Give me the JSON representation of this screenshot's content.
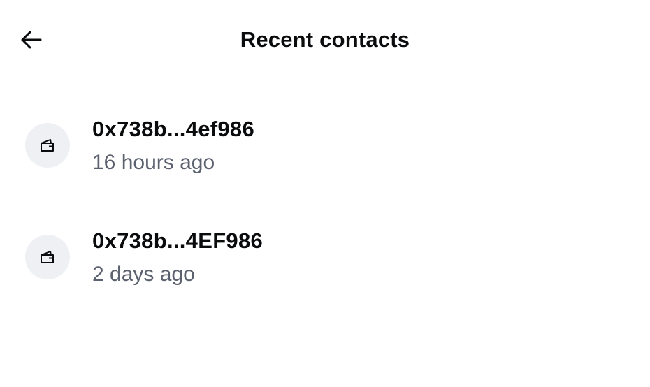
{
  "header": {
    "title": "Recent contacts",
    "back_icon": "arrow-left-icon"
  },
  "contacts": [
    {
      "address": "0x738b...4ef986",
      "time": "16 hours ago",
      "icon": "wallet-icon"
    },
    {
      "address": "0x738b...4EF986",
      "time": "2 days ago",
      "icon": "wallet-icon"
    }
  ],
  "colors": {
    "text_primary": "#0a0b0d",
    "text_secondary": "#5b616e",
    "avatar_bg": "#eef0f3",
    "background": "#ffffff"
  }
}
